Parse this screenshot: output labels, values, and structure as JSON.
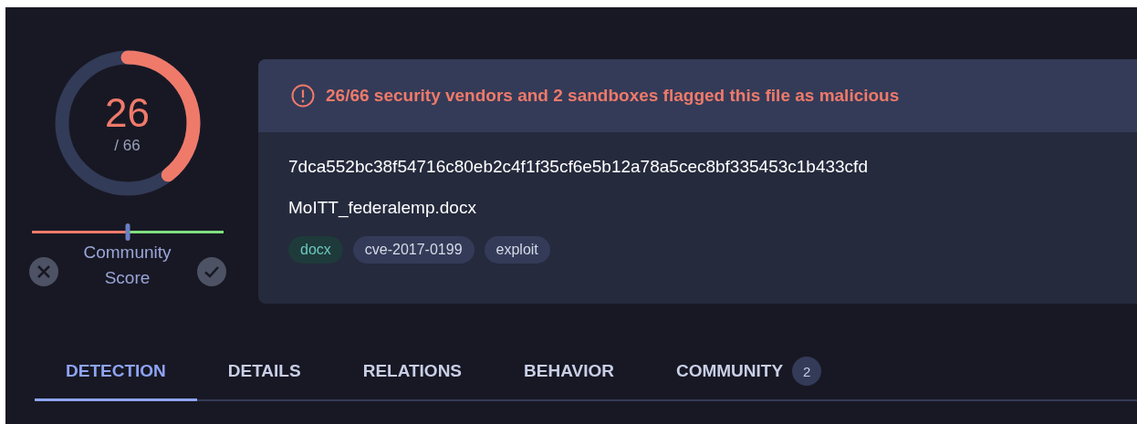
{
  "score": {
    "detections": "26",
    "total": "/ 66",
    "level": 0.394
  },
  "community_score": {
    "label": "Community Score",
    "level": 0.5
  },
  "summary": {
    "alert": "26/66 security vendors and 2 sandboxes flagged this file as malicious",
    "hash": "7dca552bc38f54716c80eb2c4f1f35cf6e5b12a78a5cec8bf335453c1b433cfd",
    "filename": "MoITT_federalemp.docx",
    "tags": [
      {
        "label": "docx",
        "kind": "filetype"
      },
      {
        "label": "cve-2017-0199",
        "kind": "tag"
      },
      {
        "label": "exploit",
        "kind": "tag"
      }
    ]
  },
  "tabs": [
    {
      "label": "DETECTION",
      "selected": true
    },
    {
      "label": "DETAILS",
      "selected": false
    },
    {
      "label": "RELATIONS",
      "selected": false
    },
    {
      "label": "BEHAVIOR",
      "selected": false
    },
    {
      "label": "COMMUNITY",
      "selected": false,
      "count": "2"
    }
  ]
}
